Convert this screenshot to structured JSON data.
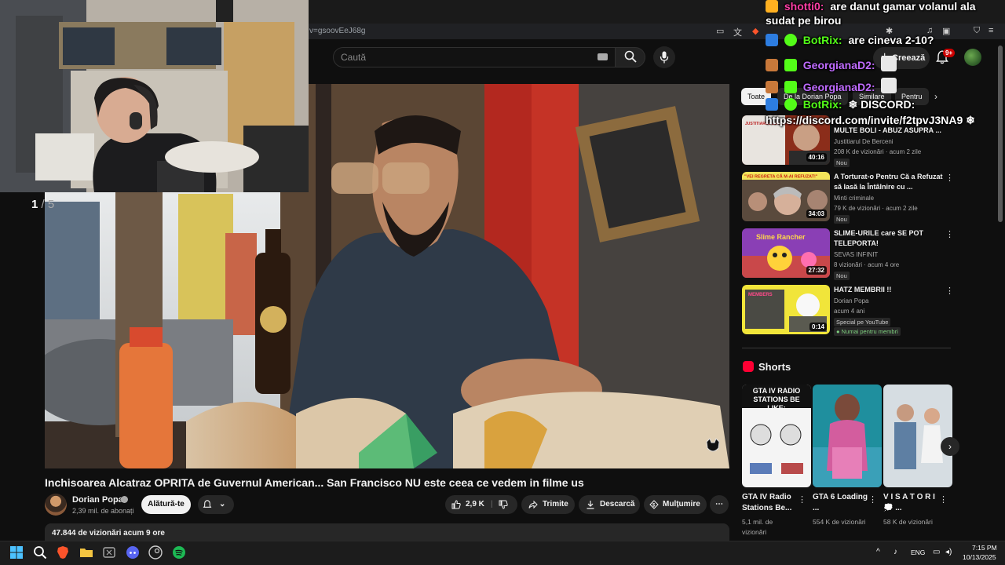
{
  "browser": {
    "url_fragment": "v=gsoovEeJ68g"
  },
  "header": {
    "search_placeholder": "Caută",
    "create_label": "Creează",
    "notifications_count": "9+"
  },
  "player": {
    "slide_current": "1",
    "slide_total": "/ 5"
  },
  "video": {
    "title": "Inchisoarea Alcatraz OPRITA de Guvernul American... San Francisco NU este ceea ce vedem in filme us",
    "channel_name": "Dorian Popa",
    "subscribers": "2,39 mil. de abonați",
    "join_label": "Alătură-te",
    "likes": "2,9 K",
    "share_label": "Trimite",
    "download_label": "Descarcă",
    "thanks_label": "Mulțumire",
    "views_line": "47.844 de vizionări  acum 9 ore"
  },
  "chips": [
    "Toate",
    "De la Dorian Popa",
    "Similare",
    "Pentru"
  ],
  "recommendations": [
    {
      "title": "MULTE BOLI - ABUZ ASUPRA ...",
      "channel": "Justitiarul De Berceni",
      "meta": "208 K de vizionări · acum 2 zile",
      "badge": "Nou",
      "duration": "40:16",
      "thumb_text": "JUSTITIARUL DE BERCENI"
    },
    {
      "title": "A Torturat-o Pentru Că a Refuzat să Iasă la Întâlnire cu ...",
      "channel": "Minti criminale",
      "meta": "79 K de vizionări · acum 2 zile",
      "badge": "Nou",
      "duration": "34:03",
      "thumb_text": "\"VEI REGRETA CĂ M-AI REFUZAT!\""
    },
    {
      "title": "SLIME-URILE care SE POT TELEPORTA!",
      "channel": "SEVAS INFINIT",
      "meta": "8 vizionări · acum 4 ore",
      "badge": "Nou",
      "duration": "27:32",
      "thumb_text": "Slime Rancher"
    },
    {
      "title": "HATZ MEMBRII !!",
      "channel": "Dorian Popa",
      "meta": "acum 4 ani",
      "badge": "Special pe YouTube",
      "badge2": "Numai pentru membri",
      "duration": "0:14",
      "thumb_text": "MEMBERS"
    }
  ],
  "shorts": {
    "heading": "Shorts",
    "items": [
      {
        "title": "GTA IV Radio Stations Be...",
        "views": "5,1 mil. de vizionări",
        "thumb_text": "GTA IV RADIO STATIONS BE LIKE:"
      },
      {
        "title": "GTA 6 Loading ...",
        "views": "554 K de vizionări"
      },
      {
        "title": "V I S A T O R I 💭 ...",
        "views": "58 K de vizionări"
      }
    ]
  },
  "chat": [
    {
      "name": "shotti0:",
      "message": "are danut gamar volanul ala",
      "color": "#ff3ea5"
    },
    {
      "name": "",
      "message": "sudat pe birou",
      "color": "#ffffff"
    },
    {
      "name": "BotRix:",
      "message": "are cineva 2-10?",
      "color": "#53fc18"
    },
    {
      "name": "GeorgianaD2:",
      "message": "",
      "color": "#c06bff"
    },
    {
      "name": "GeorgianaD2:",
      "message": "",
      "color": "#c06bff"
    },
    {
      "name": "BotRix:",
      "message": "❄ DISCORD:",
      "color": "#53fc18"
    },
    {
      "name": "",
      "message": "https://discord.com/invite/f2tpvJ3NA9 ❄",
      "color": "#ffffff"
    }
  ],
  "taskbar": {
    "lang": "ENG",
    "time": "7:15 PM",
    "date": "10/13/2025"
  },
  "colors": {
    "bg": "#0f0f0f",
    "accent_red": "#ff0033",
    "chip_active": "#f1f1f1",
    "kick_green": "#53fc18"
  }
}
